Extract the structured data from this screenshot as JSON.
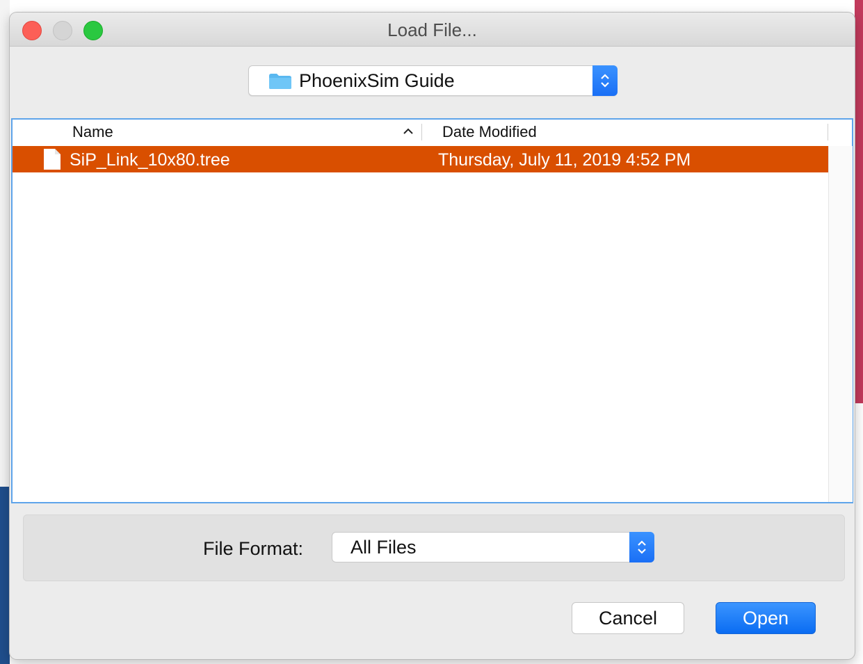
{
  "dialog": {
    "title": "Load File..."
  },
  "location": {
    "folder_name": "PhoenixSim Guide",
    "folder_icon": "folder-icon"
  },
  "file_list": {
    "columns": [
      "Name",
      "Date Modified"
    ],
    "sort_column": "Name",
    "sort_direction": "ascending",
    "rows": [
      {
        "name": "SiP_Link_10x80.tree",
        "date_modified": "Thursday, July 11, 2019 4:52 PM",
        "icon": "document-icon",
        "selected": true
      }
    ]
  },
  "format": {
    "label": "File Format:",
    "selected": "All Files"
  },
  "buttons": {
    "cancel": "Cancel",
    "open": "Open"
  },
  "colors": {
    "selection": "#d94f00",
    "accent": "#1a6ff5",
    "close": "#fc5f57",
    "maximize": "#2ac840"
  }
}
